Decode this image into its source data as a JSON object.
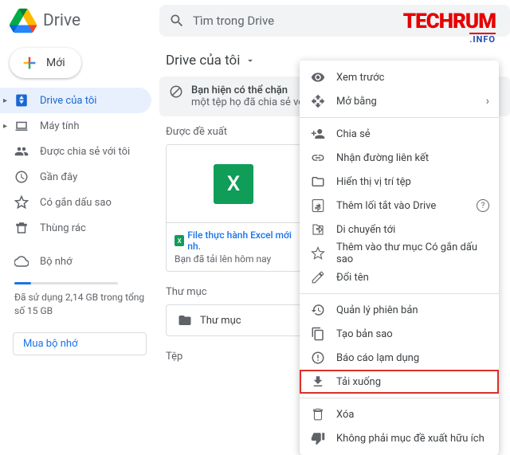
{
  "brand": "Drive",
  "search_placeholder": "Tìm trong Drive",
  "watermark": {
    "main": "TECHRUM",
    "sub": ".INFO"
  },
  "new_button": "Mới",
  "sidebar": {
    "items": [
      {
        "label": "Drive của tôi"
      },
      {
        "label": "Máy tính"
      },
      {
        "label": "Được chia sẻ với tôi"
      },
      {
        "label": "Gần đây"
      },
      {
        "label": "Có gắn dấu sao"
      },
      {
        "label": "Thùng rác"
      },
      {
        "label": "Bộ nhớ"
      }
    ],
    "storage_text": "Đã sử dụng 2,14 GB trong tổng số 15 GB",
    "buy_storage": "Mua bộ nhớ"
  },
  "main": {
    "breadcrumb": "Drive của tôi",
    "banner_l1": "Bạn hiện có thể chặn",
    "banner_l2": "một tệp họ đã chia sẻ vớ",
    "suggested_label": "Được đề xuất",
    "file": {
      "glyph": "X",
      "name": "File thực hành Excel mới nh.",
      "subtitle": "Bạn đã tải lên hôm nay"
    },
    "folders_label": "Thư mục",
    "folder_name": "Thư mục",
    "files_label": "Tệp"
  },
  "ctx": {
    "preview": "Xem trước",
    "open_with": "Mở bằng",
    "share": "Chia sẻ",
    "get_link": "Nhận đường liên kết",
    "show_loc": "Hiển thị vị trí tệp",
    "add_shortcut": "Thêm lối tắt vào Drive",
    "move_to": "Di chuyển tới",
    "add_starred": "Thêm vào thư mục Có gắn dấu sao",
    "rename": "Đổi tên",
    "manage_versions": "Quản lý phiên bản",
    "make_copy": "Tạo bản sao",
    "report_abuse": "Báo cáo lạm dụng",
    "download": "Tải xuống",
    "remove": "Xóa",
    "not_helpful": "Không phải mục đề xuất hữu ích"
  }
}
